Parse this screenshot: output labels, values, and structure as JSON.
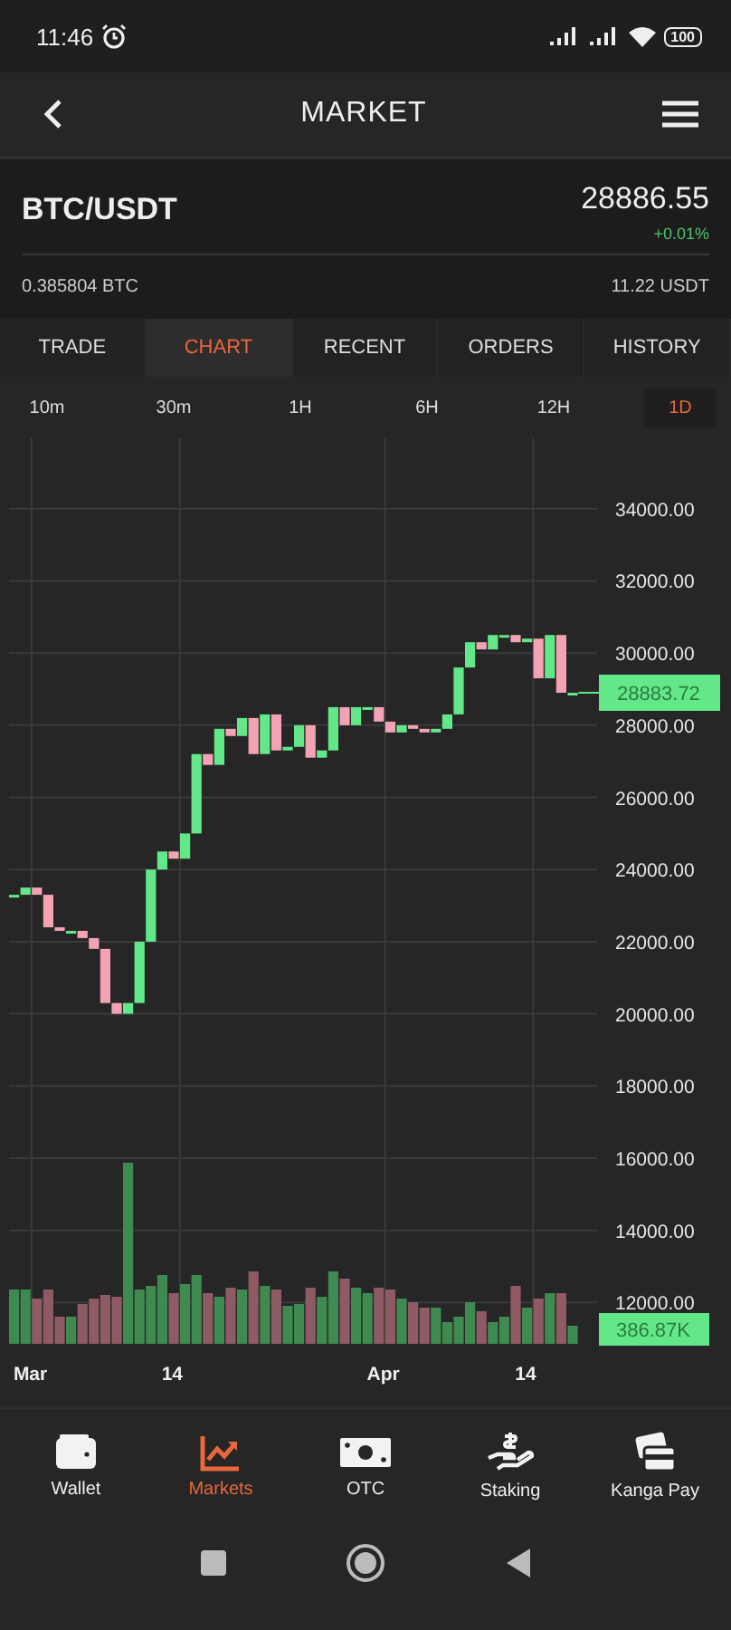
{
  "status_bar": {
    "time": "11:46",
    "battery": "100"
  },
  "header": {
    "title": "MARKET"
  },
  "pair": {
    "symbol": "BTC/USDT",
    "price": "28886.55",
    "change": "+0.01%",
    "base_balance": "0.385804 BTC",
    "quote_balance": "11.22 USDT"
  },
  "tabs": [
    {
      "label": "TRADE",
      "selected": false
    },
    {
      "label": "CHART",
      "selected": true
    },
    {
      "label": "RECENT",
      "selected": false
    },
    {
      "label": "ORDERS",
      "selected": false
    },
    {
      "label": "HISTORY",
      "selected": false
    }
  ],
  "intervals": [
    {
      "label": "10m",
      "selected": false
    },
    {
      "label": "30m",
      "selected": false
    },
    {
      "label": "1H",
      "selected": false
    },
    {
      "label": "6H",
      "selected": false
    },
    {
      "label": "12H",
      "selected": false
    },
    {
      "label": "1D",
      "selected": true
    }
  ],
  "chart": {
    "price_tag": "28883.72",
    "volume_tag": "386.87K",
    "x_labels": [
      "Mar",
      "14",
      "Apr",
      "14"
    ],
    "y_labels": [
      "34000.00",
      "32000.00",
      "30000.00",
      "28000.00",
      "26000.00",
      "24000.00",
      "22000.00",
      "20000.00",
      "18000.00",
      "16000.00",
      "14000.00",
      "12000.00"
    ]
  },
  "bottom_nav": [
    {
      "label": "Wallet",
      "kind": "wallet",
      "selected": false
    },
    {
      "label": "Markets",
      "kind": "chart",
      "selected": true
    },
    {
      "label": "OTC",
      "kind": "cash",
      "selected": false
    },
    {
      "label": "Staking",
      "kind": "hand",
      "selected": false
    },
    {
      "label": "Kanga Pay",
      "kind": "cards",
      "selected": false
    }
  ]
}
